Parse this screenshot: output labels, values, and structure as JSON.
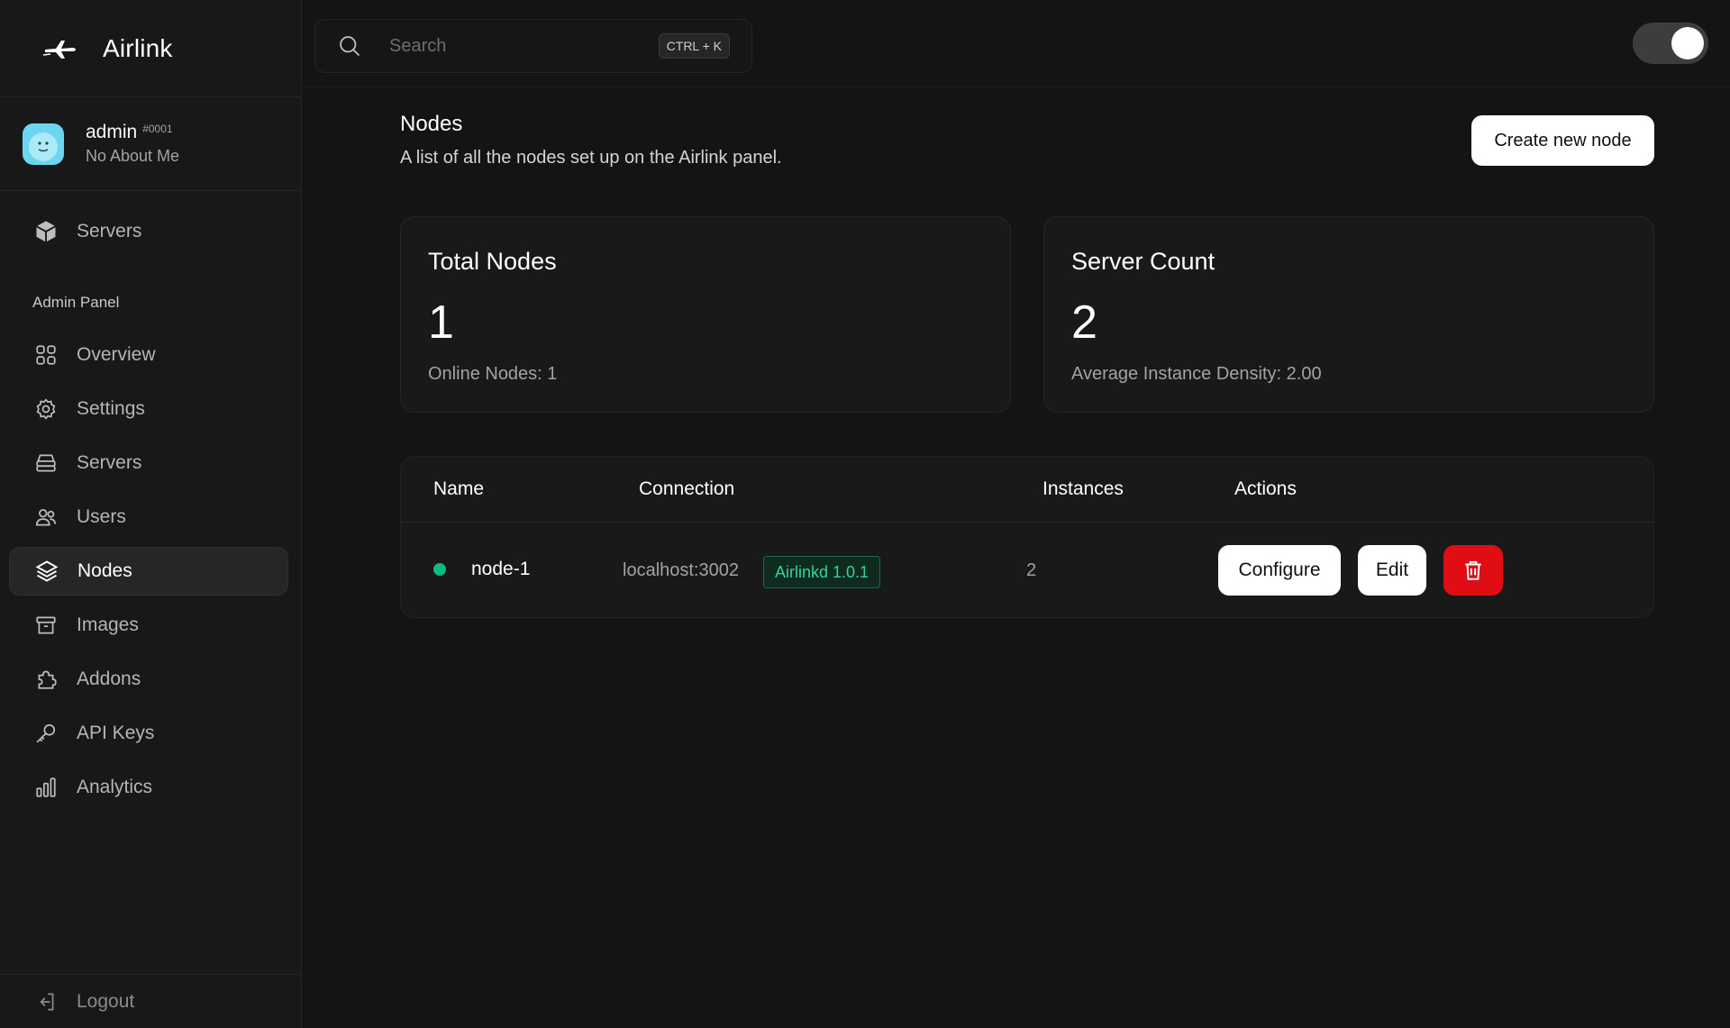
{
  "brand": {
    "name": "Airlink"
  },
  "user": {
    "name": "admin",
    "tag": "#0001",
    "about": "No About Me"
  },
  "sidebar": {
    "top_items": [
      {
        "label": "Servers",
        "icon": "cube-icon"
      }
    ],
    "section_label": "Admin Panel",
    "admin_items": [
      {
        "label": "Overview",
        "icon": "grid-icon"
      },
      {
        "label": "Settings",
        "icon": "gear-icon"
      },
      {
        "label": "Servers",
        "icon": "server-icon"
      },
      {
        "label": "Users",
        "icon": "users-icon"
      },
      {
        "label": "Nodes",
        "icon": "layers-icon",
        "active": true
      },
      {
        "label": "Images",
        "icon": "archive-icon"
      },
      {
        "label": "Addons",
        "icon": "puzzle-icon"
      },
      {
        "label": "API Keys",
        "icon": "key-icon"
      },
      {
        "label": "Analytics",
        "icon": "bar-chart-icon"
      }
    ],
    "logout_label": "Logout"
  },
  "search": {
    "placeholder": "Search",
    "shortcut": "CTRL + K"
  },
  "page": {
    "title": "Nodes",
    "subtitle": "A list of all the nodes set up on the Airlink panel.",
    "create_label": "Create new node"
  },
  "stats": {
    "total_nodes": {
      "title": "Total Nodes",
      "value": "1",
      "note": "Online Nodes: 1"
    },
    "server_count": {
      "title": "Server Count",
      "value": "2",
      "note": "Average Instance Density: 2.00"
    }
  },
  "table": {
    "headers": [
      "Name",
      "Connection",
      "Instances",
      "Actions"
    ],
    "rows": [
      {
        "name": "node-1",
        "connection": "localhost:3002",
        "version_badge": "Airlinkd 1.0.1",
        "instances": "2",
        "status": "online",
        "configure_label": "Configure",
        "edit_label": "Edit"
      }
    ]
  },
  "colors": {
    "accent_online": "#10b981",
    "danger": "#e00d14",
    "badge_text": "#34d399",
    "avatar": "#6cd6f0"
  }
}
